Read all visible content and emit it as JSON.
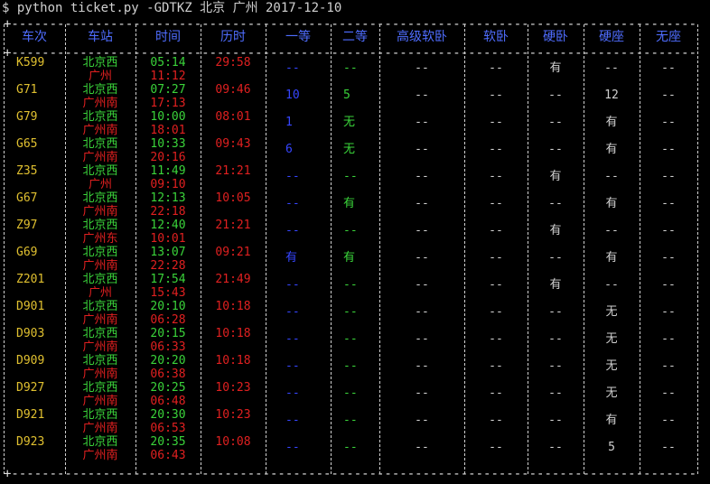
{
  "terminal": {
    "prompt": "$ python ticket.py -GDTKZ 北京 广州 2017-12-10"
  },
  "table": {
    "headers": [
      "车次",
      "车站",
      "时间",
      "历时",
      "一等",
      "二等",
      "高级软卧",
      "软卧",
      "硬卧",
      "硬座",
      "无座"
    ],
    "rows": [
      {
        "train": "K599",
        "from": "北京西",
        "to": "广州",
        "dep": "05:14",
        "arr": "11:12",
        "dur": "29:58",
        "first": "--",
        "second": "--",
        "gjrw": "--",
        "rw": "--",
        "yw": "有",
        "yz": "--",
        "wz": "--"
      },
      {
        "train": "G71",
        "from": "北京西",
        "to": "广州南",
        "dep": "07:27",
        "arr": "17:13",
        "dur": "09:46",
        "first": "10",
        "second": "5",
        "gjrw": "--",
        "rw": "--",
        "yw": "--",
        "yz": "12",
        "wz": "--"
      },
      {
        "train": "G79",
        "from": "北京西",
        "to": "广州南",
        "dep": "10:00",
        "arr": "18:01",
        "dur": "08:01",
        "first": "1",
        "second": "无",
        "gjrw": "--",
        "rw": "--",
        "yw": "--",
        "yz": "有",
        "wz": "--"
      },
      {
        "train": "G65",
        "from": "北京西",
        "to": "广州南",
        "dep": "10:33",
        "arr": "20:16",
        "dur": "09:43",
        "first": "6",
        "second": "无",
        "gjrw": "--",
        "rw": "--",
        "yw": "--",
        "yz": "有",
        "wz": "--"
      },
      {
        "train": "Z35",
        "from": "北京西",
        "to": "广州",
        "dep": "11:49",
        "arr": "09:10",
        "dur": "21:21",
        "first": "--",
        "second": "--",
        "gjrw": "--",
        "rw": "--",
        "yw": "有",
        "yz": "--",
        "wz": "--"
      },
      {
        "train": "G67",
        "from": "北京西",
        "to": "广州南",
        "dep": "12:13",
        "arr": "22:18",
        "dur": "10:05",
        "first": "--",
        "second": "有",
        "gjrw": "--",
        "rw": "--",
        "yw": "--",
        "yz": "有",
        "wz": "--"
      },
      {
        "train": "Z97",
        "from": "北京西",
        "to": "广州东",
        "dep": "12:40",
        "arr": "10:01",
        "dur": "21:21",
        "first": "--",
        "second": "--",
        "gjrw": "--",
        "rw": "--",
        "yw": "有",
        "yz": "--",
        "wz": "--"
      },
      {
        "train": "G69",
        "from": "北京西",
        "to": "广州南",
        "dep": "13:07",
        "arr": "22:28",
        "dur": "09:21",
        "first": "有",
        "second": "有",
        "gjrw": "--",
        "rw": "--",
        "yw": "--",
        "yz": "有",
        "wz": "--"
      },
      {
        "train": "Z201",
        "from": "北京西",
        "to": "广州",
        "dep": "17:54",
        "arr": "15:43",
        "dur": "21:49",
        "first": "--",
        "second": "--",
        "gjrw": "--",
        "rw": "--",
        "yw": "有",
        "yz": "--",
        "wz": "--"
      },
      {
        "train": "D901",
        "from": "北京西",
        "to": "广州南",
        "dep": "20:10",
        "arr": "06:28",
        "dur": "10:18",
        "first": "--",
        "second": "--",
        "gjrw": "--",
        "rw": "--",
        "yw": "--",
        "yz": "无",
        "wz": "--"
      },
      {
        "train": "D903",
        "from": "北京西",
        "to": "广州南",
        "dep": "20:15",
        "arr": "06:33",
        "dur": "10:18",
        "first": "--",
        "second": "--",
        "gjrw": "--",
        "rw": "--",
        "yw": "--",
        "yz": "无",
        "wz": "--"
      },
      {
        "train": "D909",
        "from": "北京西",
        "to": "广州南",
        "dep": "20:20",
        "arr": "06:38",
        "dur": "10:18",
        "first": "--",
        "second": "--",
        "gjrw": "--",
        "rw": "--",
        "yw": "--",
        "yz": "无",
        "wz": "--"
      },
      {
        "train": "D927",
        "from": "北京西",
        "to": "广州南",
        "dep": "20:25",
        "arr": "06:48",
        "dur": "10:23",
        "first": "--",
        "second": "--",
        "gjrw": "--",
        "rw": "--",
        "yw": "--",
        "yz": "无",
        "wz": "--"
      },
      {
        "train": "D921",
        "from": "北京西",
        "to": "广州南",
        "dep": "20:30",
        "arr": "06:53",
        "dur": "10:23",
        "first": "--",
        "second": "--",
        "gjrw": "--",
        "rw": "--",
        "yw": "--",
        "yz": "有",
        "wz": "--"
      },
      {
        "train": "D923",
        "from": "北京西",
        "to": "广州南",
        "dep": "20:35",
        "arr": "06:43",
        "dur": "10:08",
        "first": "--",
        "second": "--",
        "gjrw": "--",
        "rw": "--",
        "yw": "--",
        "yz": "5",
        "wz": "--"
      }
    ]
  },
  "colors": {
    "background": "#000000",
    "header": "#4f6dff",
    "train": "#e0c030",
    "departure": "#3ad33a",
    "arrival": "#e02020",
    "first_class": "#3545ff",
    "second_class": "#3ad33a"
  }
}
